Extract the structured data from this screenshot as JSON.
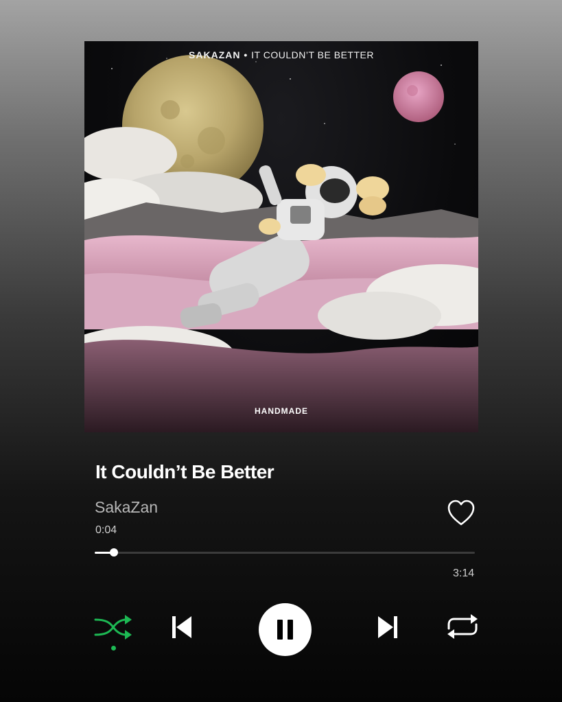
{
  "album": {
    "header_artist": "SAKAZAN",
    "header_separator": "•",
    "header_title": "IT COULDN’T BE BETTER",
    "label": "HANDMADE"
  },
  "track": {
    "title": "It Couldn’t Be Better",
    "artist": "SakaZan",
    "elapsed": "0:04",
    "duration": "3:14",
    "progress_fraction": 0.05
  },
  "icons": {
    "like": "heart-outline-icon",
    "shuffle": "shuffle-icon",
    "previous": "skip-previous-icon",
    "play_pause": "pause-icon",
    "next": "skip-next-icon",
    "repeat": "repeat-icon"
  },
  "controls": {
    "shuffle_active": true
  },
  "colors": {
    "accent": "#1db954",
    "text_primary": "#ffffff",
    "text_secondary": "#b8b8b8"
  }
}
